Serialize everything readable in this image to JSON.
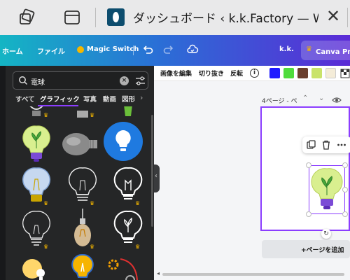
{
  "browser": {
    "tab_title": "ダッシュボード ‹ k.k.Factory — WordPress",
    "close_glyph": "✕"
  },
  "canva_toolbar": {
    "home": "ホーム",
    "file": "ファイル",
    "magic_switch": "Magic Switch",
    "user": "k.k.",
    "pro": "Canva Proを"
  },
  "search": {
    "value": "電球",
    "clear_glyph": "×"
  },
  "categories": [
    {
      "label": "すべて",
      "active": false
    },
    {
      "label": "グラフィック",
      "active": true
    },
    {
      "label": "写真",
      "active": false
    },
    {
      "label": "動画",
      "active": false
    },
    {
      "label": "図形",
      "active": false
    }
  ],
  "category_arrow": "›",
  "context_toolbar": {
    "edit_image": "画像を編集",
    "crop": "切り抜き",
    "flip": "反転",
    "info_glyph": "i"
  },
  "swatches": [
    "#1f1bff",
    "#4fdc3c",
    "#6b3f2e",
    "#c9e36a",
    "#f4ecd8"
  ],
  "page": {
    "label": "4ページ - ペ",
    "add_page": "+ページを追加"
  },
  "crown_glyph": "♛",
  "rotate_glyph": "↻"
}
